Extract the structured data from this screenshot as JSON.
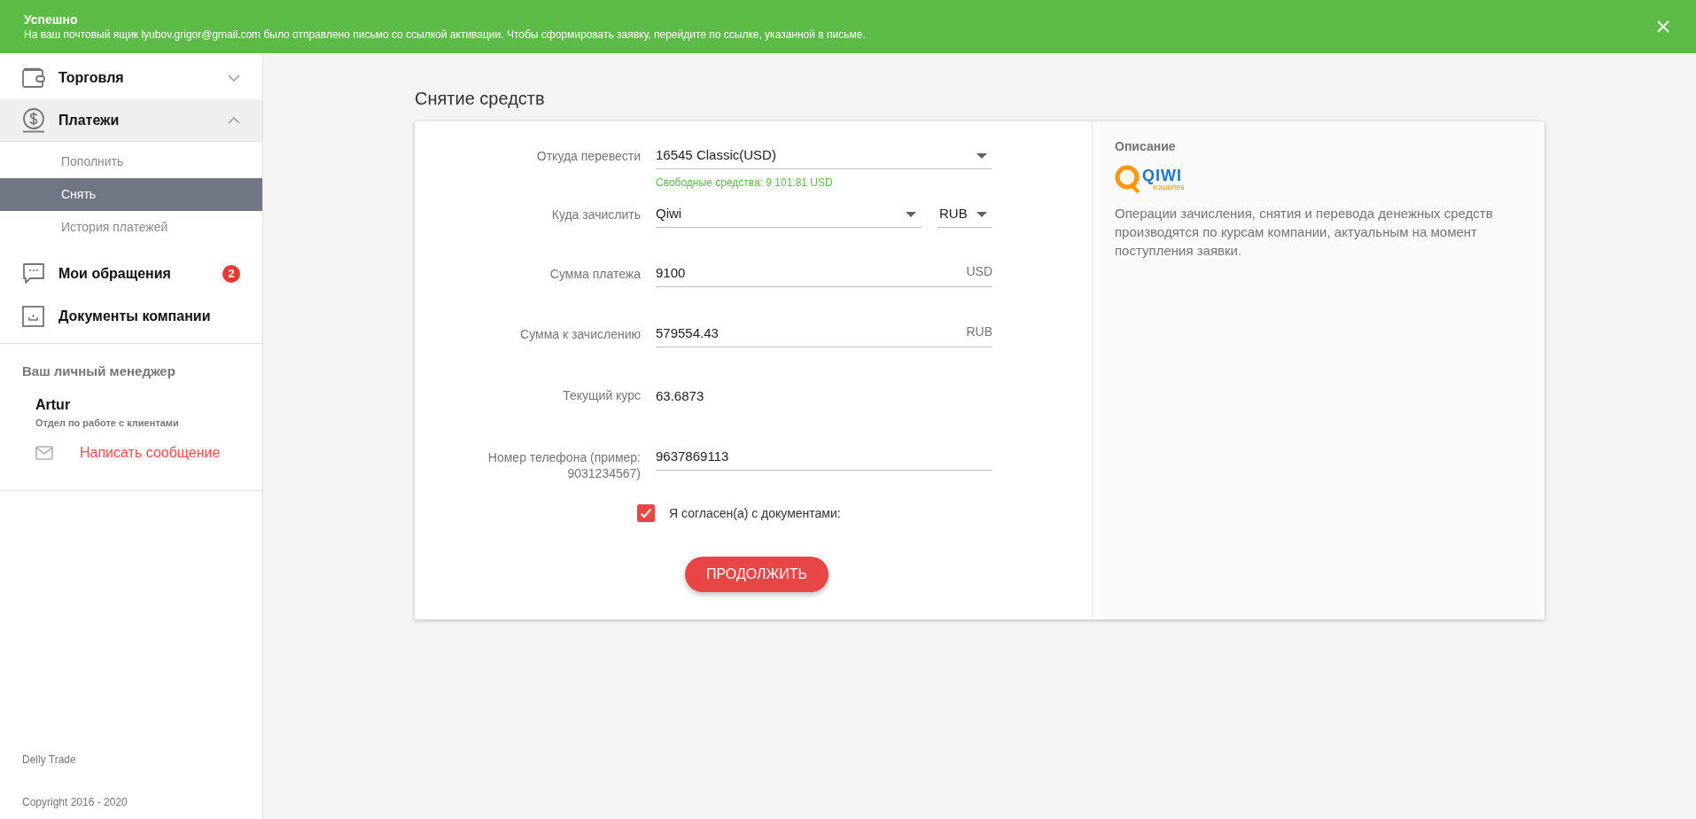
{
  "banner": {
    "title": "Успешно",
    "message": "На ваш почтовый ящик lyubov.grigor@gmail.com было отправлено письмо со ссылкой активации. Чтобы сформировать заявку, перейдите по ссылке, указанной в письме."
  },
  "sidebar": {
    "items": [
      {
        "kind": "wallet",
        "label": "Торговля",
        "expanded": false
      },
      {
        "kind": "dollar",
        "label": "Платежи",
        "expanded": true,
        "children": [
          {
            "label": "Пополнить",
            "selected": false
          },
          {
            "label": "Снять",
            "selected": true
          },
          {
            "label": "История платежей",
            "selected": false
          }
        ]
      },
      {
        "kind": "chat",
        "label": "Мои обращения",
        "badge": "2"
      },
      {
        "kind": "tray",
        "label": "Документы компании"
      }
    ],
    "manager": {
      "heading": "Ваш личный менеджер",
      "name": "Artur",
      "department": "Отдел по работе с клиентами",
      "message_link": "Написать сообщение"
    },
    "footer": [
      "Delly Trade",
      "Copyright 2016 - 2020"
    ]
  },
  "page_title": "Снятие средств",
  "form": {
    "fields": [
      {
        "kind": "select",
        "label": "Откуда перевести",
        "value": "16545 Classic(USD)",
        "hint": "Свободные средства: 9 101.81 USD"
      },
      {
        "kind": "select_pair",
        "label": "Куда зачислить",
        "value": "Qiwi",
        "currency": "RUB"
      },
      {
        "kind": "input",
        "label": "Сумма платежа",
        "value": "9100",
        "suffix": "USD"
      },
      {
        "kind": "input",
        "label": "Сумма к зачислению",
        "value": "579554.43",
        "suffix": "RUB"
      },
      {
        "kind": "text",
        "label": "Текущий курс",
        "value": "63.6873"
      },
      {
        "kind": "input",
        "label": "Номер телефона (пример: 9031234567)",
        "value": "9637869113"
      }
    ],
    "agreement": {
      "label": "Я согласен(а) с документами:",
      "checked": true
    },
    "submit": "ПРОДОЛЖИТЬ"
  },
  "description": {
    "title": "Описание",
    "logo": {
      "name": "QIWI",
      "subtitle": "кошелек"
    },
    "text": "Операции зачисления, снятия и перевода денежных средств производятся по курсам компании, актуальным на момент поступления заявки."
  }
}
